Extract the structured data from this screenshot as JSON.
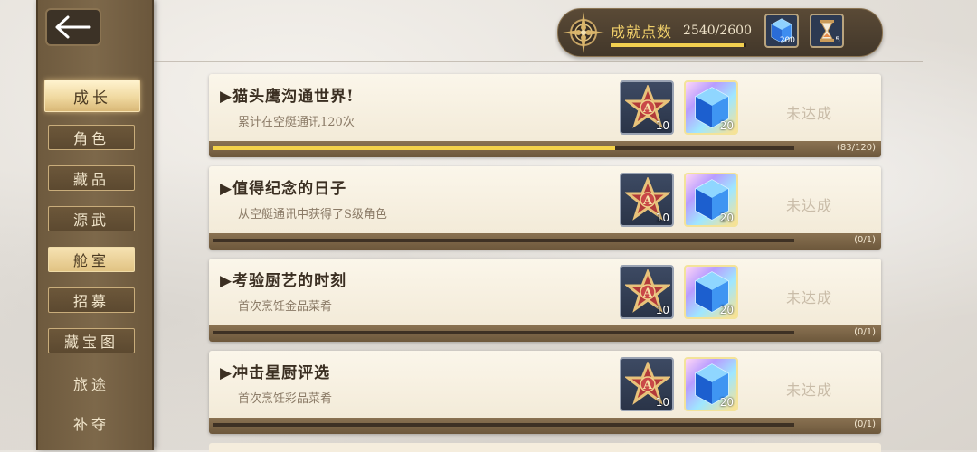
{
  "header": {
    "back_icon": "arrow-left-icon",
    "points_label": "成就点数",
    "points_value": "2540/2600",
    "points_progress": 0.977,
    "resources": [
      {
        "icon": "blue-crystal-icon",
        "count": "200"
      },
      {
        "icon": "hourglass-icon",
        "count": "5"
      }
    ]
  },
  "sidebar": {
    "items": [
      {
        "label": "成长",
        "state": "active"
      },
      {
        "label": "角色",
        "state": "normal"
      },
      {
        "label": "藏品",
        "state": "normal"
      },
      {
        "label": "源武",
        "state": "normal"
      },
      {
        "label": "舱室",
        "state": "highlight"
      },
      {
        "label": "招募",
        "state": "normal"
      },
      {
        "label": "藏宝图",
        "state": "normal"
      },
      {
        "label": "旅途",
        "state": "plain"
      },
      {
        "label": "补夺",
        "state": "plain"
      }
    ]
  },
  "achievements": [
    {
      "title": "▶猫头鹰沟通世界!",
      "desc": "累计在空艇通讯120次",
      "status": "未达成",
      "progress_text": "(83/120)",
      "progress": 0.6917,
      "rewards": [
        {
          "icon": "star-a-medal-icon",
          "qty": "10"
        },
        {
          "icon": "blue-crystal-icon",
          "qty": "20"
        }
      ]
    },
    {
      "title": "▶值得纪念的日子",
      "desc": "从空艇通讯中获得了S级角色",
      "status": "未达成",
      "progress_text": "(0/1)",
      "progress": 0,
      "rewards": [
        {
          "icon": "star-a-medal-icon",
          "qty": "10"
        },
        {
          "icon": "blue-crystal-icon",
          "qty": "20"
        }
      ]
    },
    {
      "title": "▶考验厨艺的时刻",
      "desc": "首次烹饪金品菜肴",
      "status": "未达成",
      "progress_text": "(0/1)",
      "progress": 0,
      "rewards": [
        {
          "icon": "star-a-medal-icon",
          "qty": "10"
        },
        {
          "icon": "blue-crystal-icon",
          "qty": "20"
        }
      ]
    },
    {
      "title": "▶冲击星厨评选",
      "desc": "首次烹饪彩品菜肴",
      "status": "未达成",
      "progress_text": "(0/1)",
      "progress": 0,
      "rewards": [
        {
          "icon": "star-a-medal-icon",
          "qty": "10"
        },
        {
          "icon": "blue-crystal-icon",
          "qty": "20"
        }
      ]
    }
  ],
  "colors": {
    "gold": "#f3d050",
    "panel_dark": "#42372a",
    "card_bg": "#fbf6ea",
    "status_gray": "#c9bca8"
  }
}
